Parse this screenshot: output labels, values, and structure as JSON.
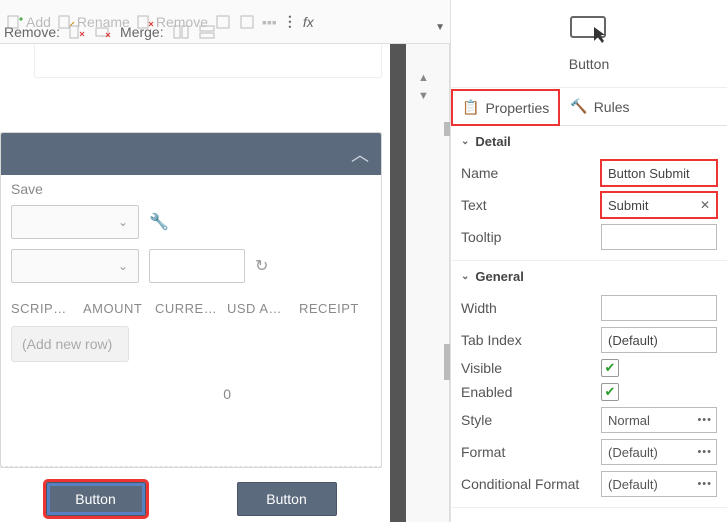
{
  "toolbar": {
    "add": "Add",
    "rename": "Rename",
    "remove_top": "Remove",
    "remove_label": "Remove:",
    "merge_label": "Merge:",
    "fx": "fx"
  },
  "form": {
    "save_label": "Save",
    "columns": [
      "SCRIP…",
      "AMOUNT",
      "CURRE…",
      "USD A…",
      "RECEIPT"
    ],
    "add_row": "(Add new row)",
    "total": "0"
  },
  "buttons": {
    "left": "Button",
    "right": "Button"
  },
  "inspector": {
    "title": "Button",
    "tabs": {
      "properties": "Properties",
      "rules": "Rules"
    },
    "detail": {
      "title": "Detail",
      "name_label": "Name",
      "name_value": "Button Submit",
      "text_label": "Text",
      "text_value": "Submit",
      "tooltip_label": "Tooltip",
      "tooltip_value": ""
    },
    "general": {
      "title": "General",
      "width_label": "Width",
      "width_value": "",
      "tabindex_label": "Tab Index",
      "tabindex_value": "(Default)",
      "visible_label": "Visible",
      "visible_value": true,
      "enabled_label": "Enabled",
      "enabled_value": true,
      "style_label": "Style",
      "style_value": "Normal",
      "format_label": "Format",
      "format_value": "(Default)",
      "cond_label": "Conditional Format",
      "cond_value": "(Default)"
    }
  }
}
